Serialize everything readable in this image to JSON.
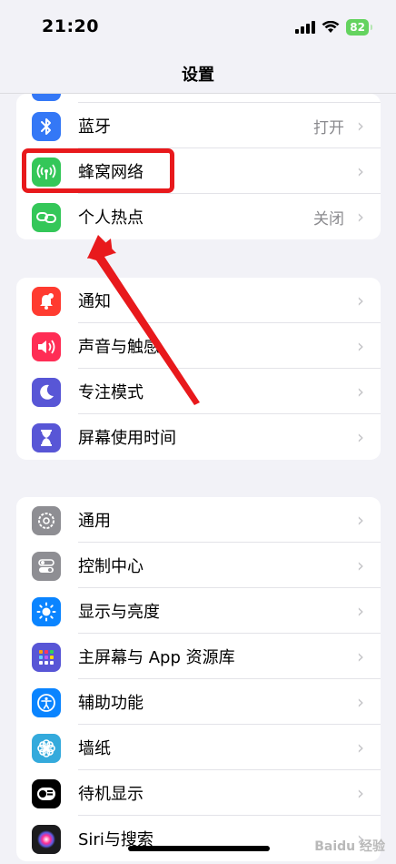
{
  "status_bar": {
    "time": "21:20",
    "battery": "82"
  },
  "nav": {
    "title": "设置"
  },
  "group1": {
    "items": [
      {
        "label": "蓝牙",
        "value": "打开",
        "icon": "bluetooth-icon",
        "color": "#3478f6"
      },
      {
        "label": "蜂窝网络",
        "value": "",
        "icon": "cellular-antenna-icon",
        "color": "#34c759"
      },
      {
        "label": "个人热点",
        "value": "关闭",
        "icon": "hotspot-chain-icon",
        "color": "#34c759"
      }
    ]
  },
  "group2": {
    "items": [
      {
        "label": "通知",
        "icon": "bell-icon",
        "color": "#ff3b30"
      },
      {
        "label": "声音与触感",
        "icon": "speaker-icon",
        "color": "#ff2d55"
      },
      {
        "label": "专注模式",
        "icon": "moon-icon",
        "color": "#5856d6"
      },
      {
        "label": "屏幕使用时间",
        "icon": "hourglass-icon",
        "color": "#5856d6"
      }
    ]
  },
  "group3": {
    "items": [
      {
        "label": "通用",
        "icon": "gear-icon",
        "color": "#8e8e93"
      },
      {
        "label": "控制中心",
        "icon": "toggles-icon",
        "color": "#8e8e93"
      },
      {
        "label": "显示与亮度",
        "icon": "sun-icon",
        "color": "#0a84ff"
      },
      {
        "label": "主屏幕与 App 资源库",
        "icon": "home-grid-icon",
        "color": "#5856d6"
      },
      {
        "label": "辅助功能",
        "icon": "accessibility-icon",
        "color": "#0a84ff"
      },
      {
        "label": "墙纸",
        "icon": "flower-icon",
        "color": "#34aadc"
      },
      {
        "label": "待机显示",
        "icon": "standby-icon",
        "color": "#000000"
      },
      {
        "label": "Siri与搜索",
        "icon": "siri-icon",
        "color": "#1c1c1e"
      }
    ]
  },
  "annotation": {
    "highlight_color": "#e8191c"
  },
  "watermark": "Baidu 经验"
}
